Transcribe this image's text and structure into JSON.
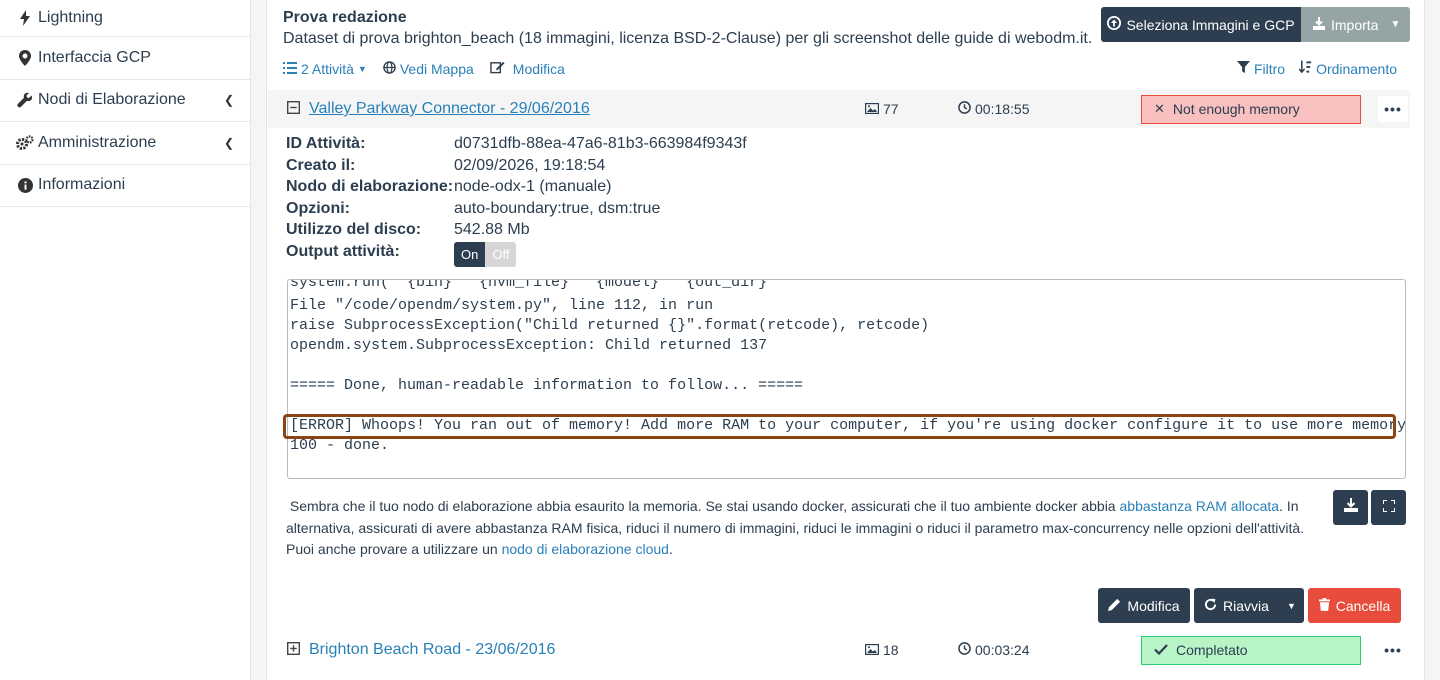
{
  "sidebar": {
    "items": [
      {
        "label": "Lightning",
        "icon": "lightning-icon"
      },
      {
        "label": "Interfaccia GCP",
        "icon": "map-marker-icon"
      },
      {
        "label": "Nodi di Elaborazione",
        "icon": "wrench-icon"
      },
      {
        "label": "Amministrazione",
        "icon": "gears-icon"
      },
      {
        "label": "Informazioni",
        "icon": "info-icon"
      }
    ]
  },
  "project": {
    "title": "Prova redazione",
    "description": "Dataset di prova brighton_beach (18 immagini, licenza BSD-2-Clause) per gli screenshot delle guide di webodm.it.",
    "select_images_label": "Seleziona Immagini e GCP",
    "import_label": "Importa",
    "tasks_label": "2 Attività",
    "view_map_label": "Vedi Mappa",
    "edit_label": "Modifica",
    "filter_label": "Filtro",
    "sort_label": "Ordinamento"
  },
  "tasks": [
    {
      "name": "Valley Parkway Connector - 29/06/2016",
      "images": "77",
      "duration": "00:18:55",
      "status": "Not enough memory",
      "details": {
        "id_label": "ID Attività:",
        "id": "d0731dfb-88ea-47a6-81b3-663984f9343f",
        "created_label": "Creato il:",
        "created": "02/09/2026, 19:18:54",
        "node_label": "Nodo di elaborazione:",
        "node": "node-odx-1 (manuale)",
        "options_label": "Opzioni:",
        "options": "auto-boundary:true, dsm:true",
        "disk_label": "Utilizzo del disco:",
        "disk": "542.88 Mb",
        "output_label": "Output attività:",
        "toggle_on": "On",
        "toggle_off": "Off"
      },
      "console": [
        "system.run('\"{bin}\" \"{nvm_file}\" \"{model}\" \"{out_dir}\" '",
        "File \"/code/opendm/system.py\", line 112, in run",
        "raise SubprocessException(\"Child returned {}\".format(retcode), retcode)",
        "opendm.system.SubprocessException: Child returned 137",
        "",
        "===== Done, human-readable information to follow... =====",
        "",
        "[ERROR] Whoops! You ran out of memory! Add more RAM to your computer, if you're using docker configure it to use more memory, for WSL",
        "100 - done."
      ],
      "notice": {
        "part1": "Sembra che il tuo nodo di elaborazione abbia esaurito la memoria. Se stai usando docker, assicurati che il tuo ambiente docker abbia ",
        "link1": "abbastanza RAM allocata",
        "part2": ". In alternativa, assicurati di avere abbastanza RAM fisica, riduci il numero di immagini, riduci le immagini o riduci il parametro max-concurrency nelle opzioni dell'attività. Puoi anche provare a utilizzare un ",
        "link2": "nodo di elaborazione cloud",
        "part3": "."
      },
      "actions": {
        "edit": "Modifica",
        "restart": "Riavvia",
        "delete": "Cancella"
      }
    },
    {
      "name": "Brighton Beach Road - 23/06/2016",
      "images": "18",
      "duration": "00:03:24",
      "status": "Completato"
    }
  ],
  "colors": {
    "primary": "#2c3e50",
    "link": "#2980b9",
    "danger": "#e74c3c",
    "error_bg": "#f9c0c0",
    "success_bg": "#b7f5c7",
    "error_highlight": "#8b4513"
  }
}
